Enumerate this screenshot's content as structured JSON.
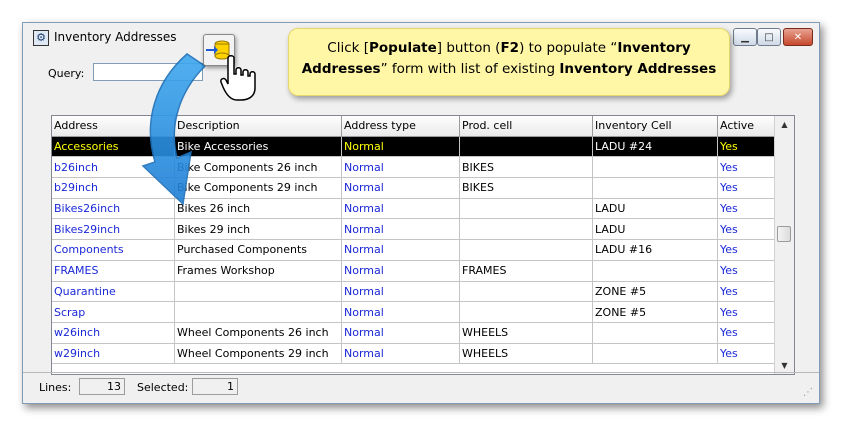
{
  "window": {
    "title": "Inventory Addresses"
  },
  "query": {
    "label": "Query:",
    "value": ""
  },
  "tooltip": {
    "t1": "Click [",
    "t2": "Populate",
    "t3": "] button (",
    "t4": "F2",
    "t5": ") to populate “",
    "t6": "Inventory Addresses",
    "t7": "” form with list of existing ",
    "t8": "Inventory Addresses"
  },
  "table": {
    "columns": [
      "Address",
      "Description",
      "Address type",
      "Prod. cell",
      "Inventory Cell",
      "Active"
    ],
    "rows": [
      [
        "Accessories",
        "Bike Accessories",
        "Normal",
        "",
        "LADU #24",
        "Yes"
      ],
      [
        "b26inch",
        "Bike Components 26 inch",
        "Normal",
        "BIKES",
        "",
        "Yes"
      ],
      [
        "b29inch",
        "Bike Components 29 inch",
        "Normal",
        "BIKES",
        "",
        "Yes"
      ],
      [
        "Bikes26inch",
        "Bikes 26 inch",
        "Normal",
        "",
        "LADU",
        "Yes"
      ],
      [
        "Bikes29inch",
        "Bikes 29 inch",
        "Normal",
        "",
        "LADU",
        "Yes"
      ],
      [
        "Components",
        "Purchased Components",
        "Normal",
        "",
        "LADU #16",
        "Yes"
      ],
      [
        "FRAMES",
        "Frames Workshop",
        "Normal",
        "FRAMES",
        "",
        "Yes"
      ],
      [
        "Quarantine",
        "",
        "Normal",
        "",
        "ZONE #5",
        "Yes"
      ],
      [
        "Scrap",
        "",
        "Normal",
        "",
        "ZONE #5",
        "Yes"
      ],
      [
        "w26inch",
        "Wheel Components 26 inch",
        "Normal",
        "WHEELS",
        "",
        "Yes"
      ],
      [
        "w29inch",
        "Wheel Components 29 inch",
        "Normal",
        "WHEELS",
        "",
        "Yes"
      ]
    ],
    "selected_row": 0
  },
  "status": {
    "lines_label": "Lines:",
    "lines_value": "13",
    "selected_label": "Selected:",
    "selected_value": "1"
  },
  "icons": {
    "app": "inventory-addresses-icon",
    "populate": "populate-database-icon",
    "hand": "pointing-hand-icon",
    "arrow": "curved-arrow-icon"
  },
  "colors": {
    "link_blue": "#1a28d8",
    "selection_bg": "#000000",
    "selection_text": "#ffff00",
    "tooltip_bg": "#fff7a6"
  }
}
